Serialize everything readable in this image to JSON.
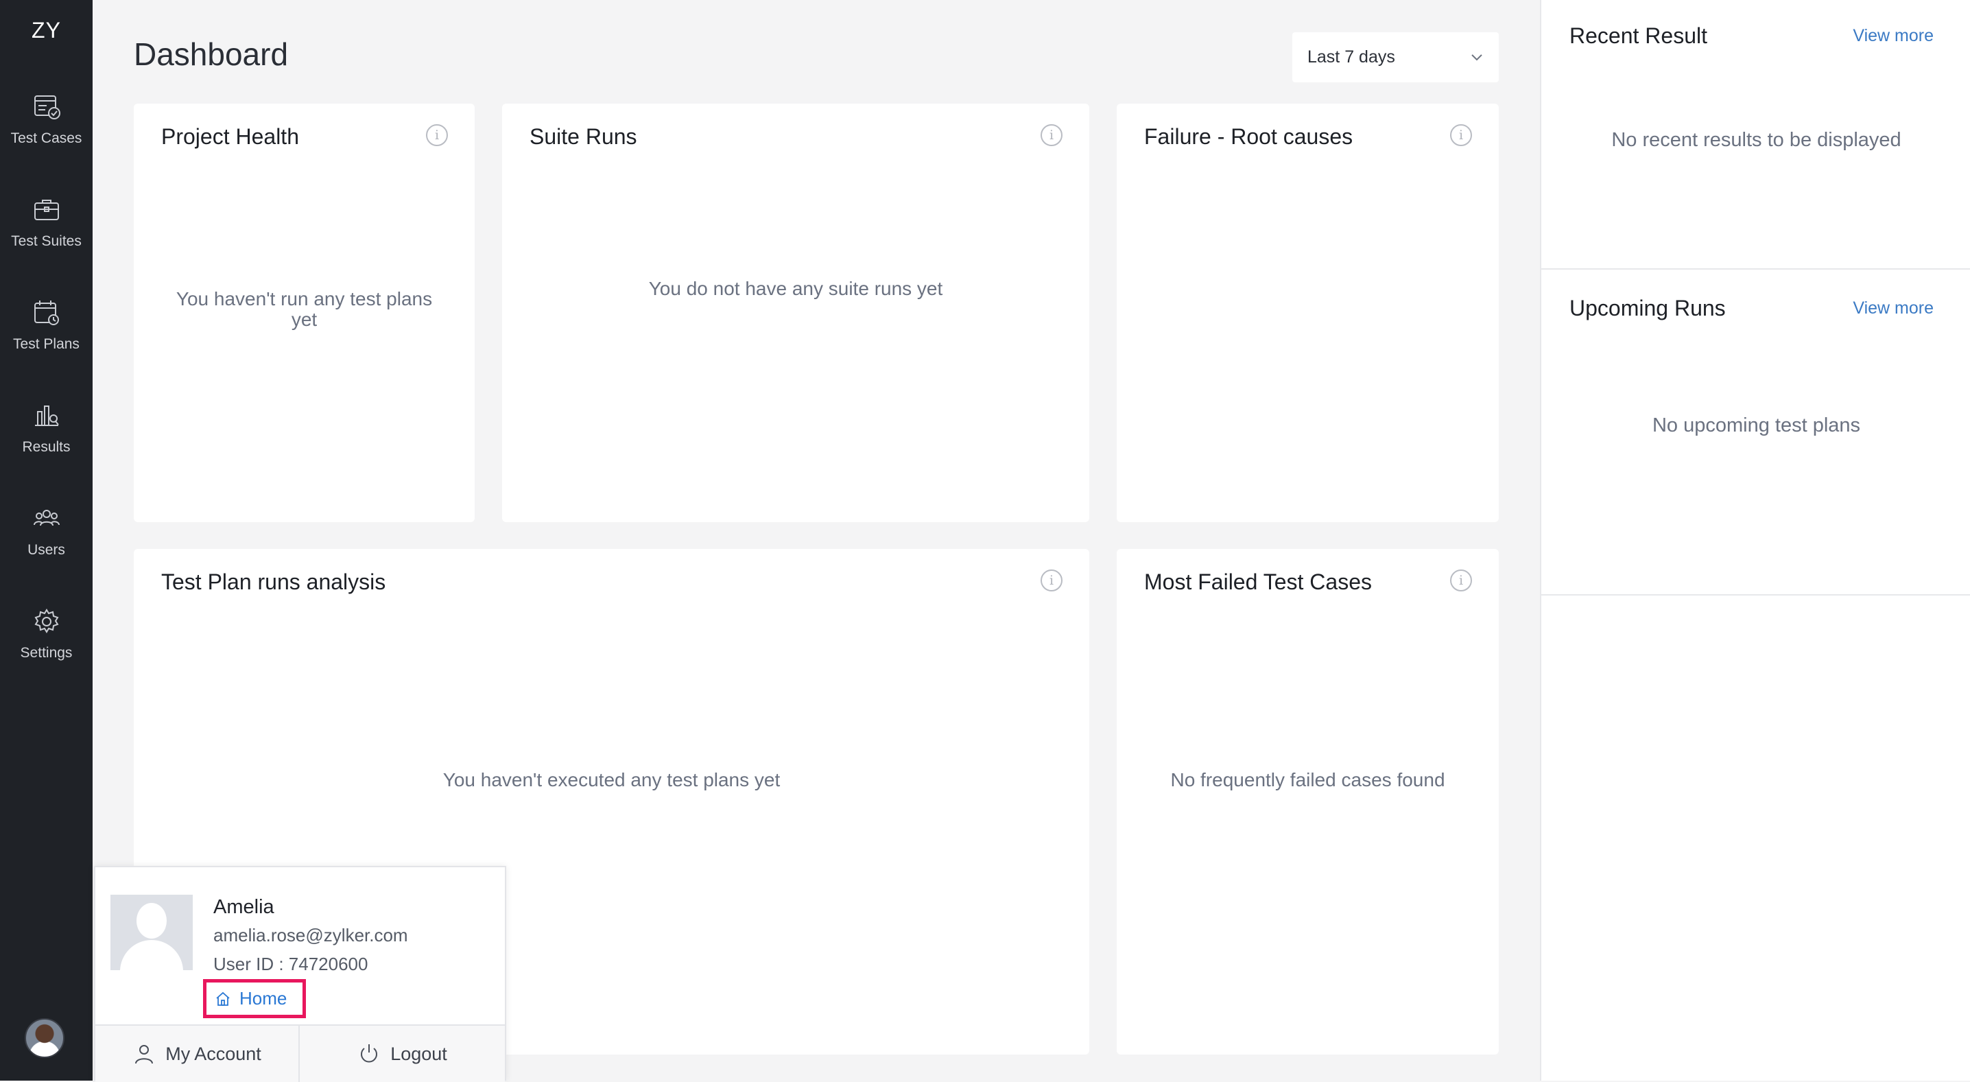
{
  "nav": {
    "brand": "ZY",
    "items": [
      {
        "label": "Test Cases",
        "icon": "test-cases-icon"
      },
      {
        "label": "Test Suites",
        "icon": "test-suites-icon"
      },
      {
        "label": "Test Plans",
        "icon": "test-plans-icon"
      },
      {
        "label": "Results",
        "icon": "results-icon"
      },
      {
        "label": "Users",
        "icon": "users-icon"
      },
      {
        "label": "Settings",
        "icon": "gear-icon"
      }
    ]
  },
  "header": {
    "title": "Dashboard",
    "range_select": "Last 7 days"
  },
  "cards": {
    "project_health": {
      "title": "Project Health",
      "empty": "You haven't run any test plans yet"
    },
    "suite_runs": {
      "title": "Suite Runs",
      "empty": "You do not have any suite runs yet"
    },
    "failure_root": {
      "title": "Failure - Root causes",
      "empty": ""
    },
    "test_plan_runs": {
      "title": "Test Plan runs analysis",
      "empty": "You haven't executed any test plans yet"
    },
    "most_failed": {
      "title": "Most Failed Test Cases",
      "empty": "No frequently failed cases found"
    }
  },
  "right_panel": {
    "recent": {
      "title": "Recent Result",
      "link": "View more",
      "empty": "No recent results to be displayed"
    },
    "upcoming": {
      "title": "Upcoming Runs",
      "link": "View more",
      "empty": "No upcoming test plans"
    }
  },
  "profile_popup": {
    "name": "Amelia",
    "email": "amelia.rose@zylker.com",
    "user_id": "User ID : 74720600",
    "home": "Home",
    "my_account": "My Account",
    "logout": "Logout"
  },
  "colors": {
    "nav_bg": "#1f2227",
    "page_bg": "#f4f4f5",
    "link": "#3b7ac4",
    "highlight_border": "#e8175d"
  }
}
